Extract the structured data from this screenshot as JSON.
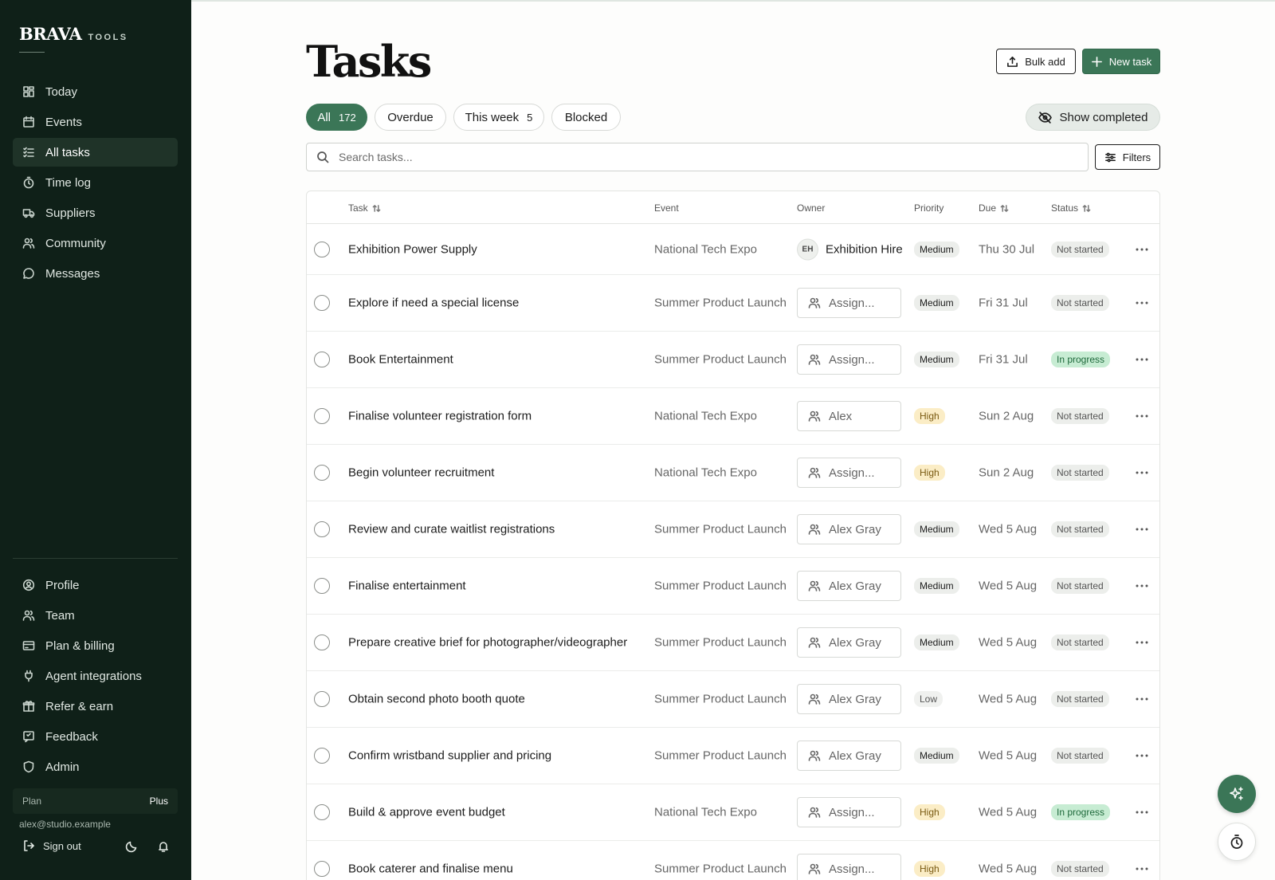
{
  "brand": {
    "name": "BRAVA",
    "suffix": "TOOLS"
  },
  "sidebar": {
    "top_items": [
      {
        "label": "Today",
        "icon": "grid-icon"
      },
      {
        "label": "Events",
        "icon": "calendar-icon"
      },
      {
        "label": "All tasks",
        "icon": "checklist-icon",
        "active": true
      },
      {
        "label": "Time log",
        "icon": "stopwatch-icon"
      },
      {
        "label": "Suppliers",
        "icon": "truck-icon"
      },
      {
        "label": "Community",
        "icon": "users-icon"
      },
      {
        "label": "Messages",
        "icon": "chat-icon"
      }
    ],
    "bottom_items": [
      {
        "label": "Profile",
        "icon": "user-circle-icon"
      },
      {
        "label": "Team",
        "icon": "users-icon"
      },
      {
        "label": "Plan & billing",
        "icon": "credit-card-icon"
      },
      {
        "label": "Agent integrations",
        "icon": "plug-icon"
      },
      {
        "label": "Refer & earn",
        "icon": "gift-icon"
      },
      {
        "label": "Feedback",
        "icon": "feedback-icon"
      },
      {
        "label": "Admin",
        "icon": "shield-icon"
      }
    ],
    "plan": {
      "label": "Plan",
      "value": "Plus"
    },
    "user_email": "alex@studio.example",
    "sign_out": "Sign out"
  },
  "header": {
    "title": "Tasks",
    "bulk_add": "Bulk add",
    "new_task": "New task"
  },
  "filters": {
    "pills": [
      {
        "label": "All",
        "count": "172",
        "active": true
      },
      {
        "label": "Overdue",
        "count": ""
      },
      {
        "label": "This week",
        "count": "5"
      },
      {
        "label": "Blocked",
        "count": ""
      }
    ],
    "show_completed": "Show completed",
    "search_placeholder": "Search tasks...",
    "filters_button": "Filters"
  },
  "table": {
    "columns": {
      "task": "Task",
      "event": "Event",
      "owner": "Owner",
      "priority": "Priority",
      "due": "Due",
      "status": "Status"
    },
    "rows": [
      {
        "task": "Exhibition Power Supply",
        "event": "National Tech Expo",
        "owner": "Exhibition Hire",
        "owner_initials": "EH",
        "owner_type": "avatar",
        "priority": "Medium",
        "due": "Thu 30 Jul",
        "status": "Not started"
      },
      {
        "task": "Explore if need a special license",
        "event": "Summer Product Launch",
        "owner": "Assign...",
        "owner_type": "chip",
        "priority": "Medium",
        "due": "Fri 31 Jul",
        "status": "Not started"
      },
      {
        "task": "Book Entertainment",
        "event": "Summer Product Launch",
        "owner": "Assign...",
        "owner_type": "chip",
        "priority": "Medium",
        "due": "Fri 31 Jul",
        "status": "In progress"
      },
      {
        "task": "Finalise volunteer registration form",
        "event": "National Tech Expo",
        "owner": "Alex",
        "owner_type": "chip",
        "priority": "High",
        "due": "Sun 2 Aug",
        "status": "Not started"
      },
      {
        "task": "Begin volunteer recruitment",
        "event": "National Tech Expo",
        "owner": "Assign...",
        "owner_type": "chip",
        "priority": "High",
        "due": "Sun 2 Aug",
        "status": "Not started"
      },
      {
        "task": "Review and curate waitlist registrations",
        "event": "Summer Product Launch",
        "owner": "Alex Gray",
        "owner_type": "chip",
        "priority": "Medium",
        "due": "Wed 5 Aug",
        "status": "Not started"
      },
      {
        "task": "Finalise entertainment",
        "event": "Summer Product Launch",
        "owner": "Alex Gray",
        "owner_type": "chip",
        "priority": "Medium",
        "due": "Wed 5 Aug",
        "status": "Not started"
      },
      {
        "task": "Prepare creative brief for photographer/videographer",
        "event": "Summer Product Launch",
        "owner": "Alex Gray",
        "owner_type": "chip",
        "priority": "Medium",
        "due": "Wed 5 Aug",
        "status": "Not started"
      },
      {
        "task": "Obtain second photo booth quote",
        "event": "Summer Product Launch",
        "owner": "Alex Gray",
        "owner_type": "chip",
        "priority": "Low",
        "due": "Wed 5 Aug",
        "status": "Not started"
      },
      {
        "task": "Confirm wristband supplier and pricing",
        "event": "Summer Product Launch",
        "owner": "Alex Gray",
        "owner_type": "chip",
        "priority": "Medium",
        "due": "Wed 5 Aug",
        "status": "Not started"
      },
      {
        "task": "Build & approve event budget",
        "event": "National Tech Expo",
        "owner": "Assign...",
        "owner_type": "chip",
        "priority": "High",
        "due": "Wed 5 Aug",
        "status": "In progress"
      },
      {
        "task": "Book caterer and finalise menu",
        "event": "Summer Product Launch",
        "owner": "Assign...",
        "owner_type": "chip",
        "priority": "High",
        "due": "Wed 5 Aug",
        "status": "Not started"
      }
    ]
  },
  "colors": {
    "accent": "#3b7657",
    "sidebar_bg": "#0f2018",
    "high_badge": "#fbedc6",
    "in_progress_badge": "#c7ecd3"
  }
}
